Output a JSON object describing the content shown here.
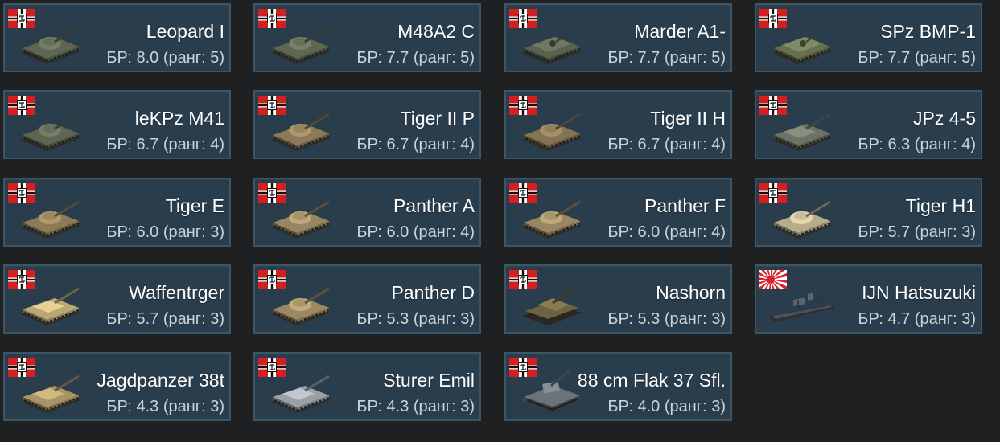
{
  "vehicles": [
    {
      "name": "Leopard I",
      "br": "БР: 8.0 (ранг: 5)",
      "nation": "germany",
      "hull": "#5d6650",
      "icon": "tank-icon"
    },
    {
      "name": "M48A2 C",
      "br": "БР: 7.7 (ранг: 5)",
      "nation": "germany",
      "hull": "#5e6752",
      "icon": "tank-icon"
    },
    {
      "name": "Marder A1-",
      "br": "БР: 7.7 (ранг: 5)",
      "nation": "germany",
      "hull": "#5a6150",
      "icon": "ifv-icon"
    },
    {
      "name": "SPz BMP-1",
      "br": "БР: 7.7 (ранг: 5)",
      "nation": "germany",
      "hull": "#66704f",
      "icon": "ifv-icon"
    },
    {
      "name": "leKPz M41",
      "br": "БР: 6.7 (ранг: 4)",
      "nation": "germany",
      "hull": "#5d6553",
      "icon": "tank-icon"
    },
    {
      "name": "Tiger II P",
      "br": "БР: 6.7 (ранг: 4)",
      "nation": "germany",
      "hull": "#8a7a58",
      "icon": "tank-icon"
    },
    {
      "name": "Tiger II H",
      "br": "БР: 6.7 (ранг: 4)",
      "nation": "germany",
      "hull": "#857454",
      "icon": "tank-icon"
    },
    {
      "name": "JPz 4-5",
      "br": "БР: 6.3 (ранг: 4)",
      "nation": "germany",
      "hull": "#6d7266",
      "icon": "tank-destroyer-icon"
    },
    {
      "name": "Tiger E",
      "br": "БР: 6.0 (ранг: 3)",
      "nation": "germany",
      "hull": "#8d7b57",
      "icon": "tank-icon"
    },
    {
      "name": "Panther A",
      "br": "БР: 6.0 (ранг: 4)",
      "nation": "germany",
      "hull": "#978661",
      "icon": "tank-icon"
    },
    {
      "name": "Panther F",
      "br": "БР: 6.0 (ранг: 4)",
      "nation": "germany",
      "hull": "#9a8762",
      "icon": "tank-icon"
    },
    {
      "name": "Tiger H1",
      "br": "БР: 5.7 (ранг: 3)",
      "nation": "germany",
      "hull": "#b8ad8a",
      "icon": "tank-icon"
    },
    {
      "name": "Waffentrger",
      "br": "БР: 5.7 (ранг: 3)",
      "nation": "germany",
      "hull": "#b9a874",
      "icon": "tank-destroyer-icon"
    },
    {
      "name": "Panther D",
      "br": "БР: 5.3 (ранг: 3)",
      "nation": "germany",
      "hull": "#9c8963",
      "icon": "tank-icon"
    },
    {
      "name": "Nashorn",
      "br": "БР: 5.3 (ранг: 3)",
      "nation": "germany",
      "hull": "#6e6244",
      "icon": "spg-icon"
    },
    {
      "name": "IJN Hatsuzuki",
      "br": "БР: 4.7 (ранг: 3)",
      "nation": "japan",
      "hull": "#4b4f59",
      "icon": "destroyer-ship-icon"
    },
    {
      "name": "Jagdpanzer 38t",
      "br": "БР: 4.3 (ранг: 3)",
      "nation": "germany",
      "hull": "#a89466",
      "icon": "tank-destroyer-icon"
    },
    {
      "name": "Sturer Emil",
      "br": "БР: 4.3 (ранг: 3)",
      "nation": "germany",
      "hull": "#9aa0a6",
      "icon": "tank-destroyer-icon"
    },
    {
      "name": "88 cm Flak 37 Sfl.",
      "br": "БР: 4.0 (ранг: 3)",
      "nation": "germany",
      "hull": "#6c7378",
      "icon": "spaa-icon"
    }
  ]
}
